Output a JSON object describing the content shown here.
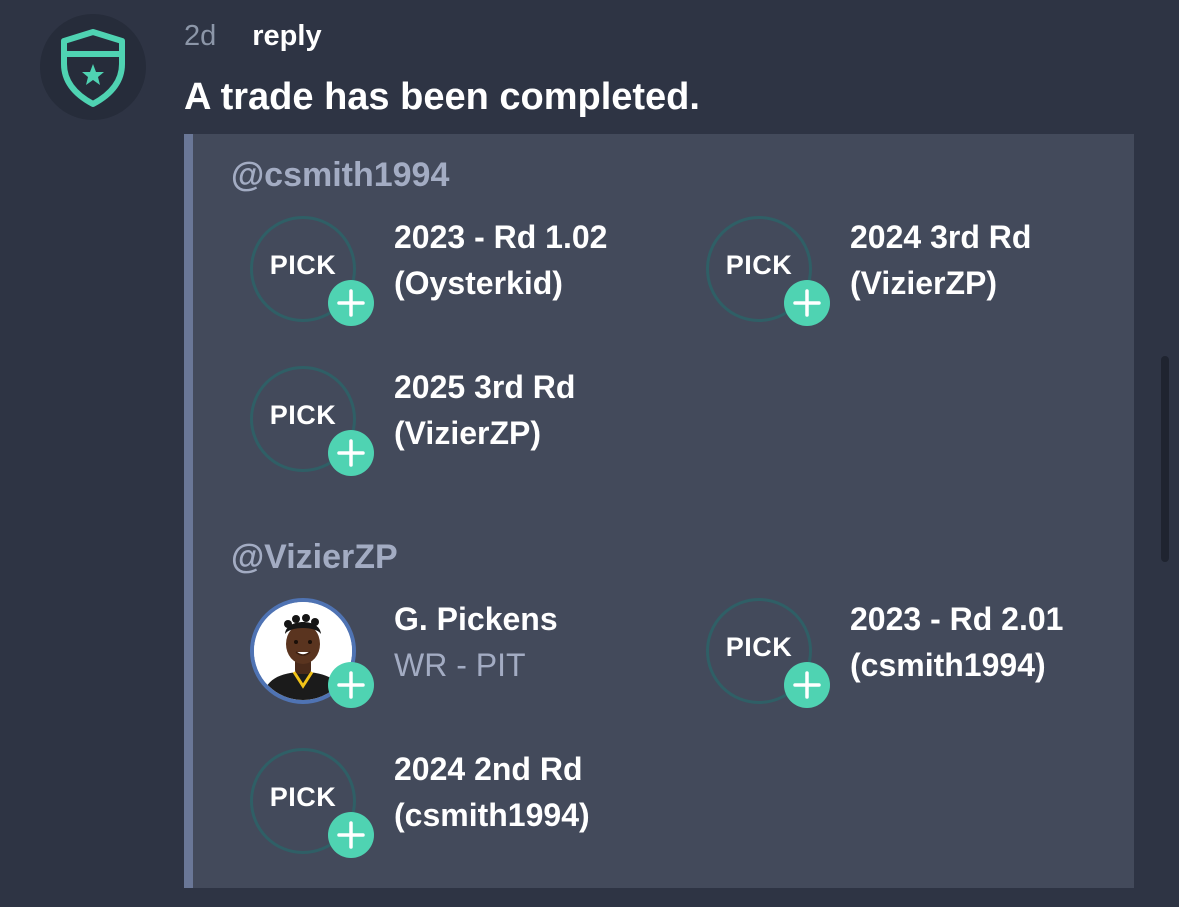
{
  "post": {
    "time": "2d",
    "reply_label": "reply",
    "message": "A trade has been completed.",
    "avatar_icon": "shield-star-icon"
  },
  "trade": {
    "sides": [
      {
        "owner": "@csmith1994",
        "assets": [
          {
            "type": "pick",
            "badge": "PICK",
            "line1": "2023 - Rd 1.02",
            "line2": "(Oysterkid)"
          },
          {
            "type": "pick",
            "badge": "PICK",
            "line1": "2024 3rd Rd",
            "line2": "(VizierZP)"
          },
          {
            "type": "pick",
            "badge": "PICK",
            "line1": "2025 3rd Rd",
            "line2": "(VizierZP)"
          }
        ]
      },
      {
        "owner": "@VizierZP",
        "assets": [
          {
            "type": "player",
            "line1": "G. Pickens",
            "line2": "WR - PIT"
          },
          {
            "type": "pick",
            "badge": "PICK",
            "line1": "2023 - Rd 2.01",
            "line2": "(csmith1994)"
          },
          {
            "type": "pick",
            "badge": "PICK",
            "line1": "2024 2nd Rd",
            "line2": "(csmith1994)"
          }
        ]
      }
    ]
  },
  "colors": {
    "background": "#2e3444",
    "card": "#434a5b",
    "card_border": "#6a7797",
    "accent": "#4fd3b2",
    "owner_text": "#a3acc3"
  }
}
